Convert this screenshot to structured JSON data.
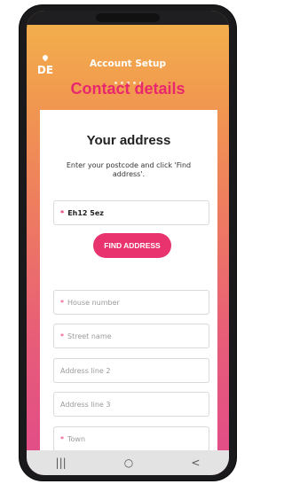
{
  "header": {
    "small_title": "Account Setup",
    "title": "Contact details",
    "logo": "DE"
  },
  "card": {
    "title": "Your address",
    "instructions": "Enter your postcode and click 'Find address'."
  },
  "postcode": {
    "value": "Eh12 5ez"
  },
  "find_button": {
    "label": "FIND ADDRESS"
  },
  "fields": {
    "house_number": "House number",
    "street_name": "Street name",
    "address_line_2": "Address line 2",
    "address_line_3": "Address line 3",
    "town": "Town"
  },
  "colors": {
    "accent": "#e8276e",
    "gradient_top": "#f3b24c",
    "gradient_bottom": "#e04a8a"
  },
  "nav": {
    "recents": "|||",
    "home": "○",
    "back": "<"
  },
  "icons": [
    "drop-logo-icon",
    "recents-icon",
    "home-icon",
    "back-icon"
  ]
}
